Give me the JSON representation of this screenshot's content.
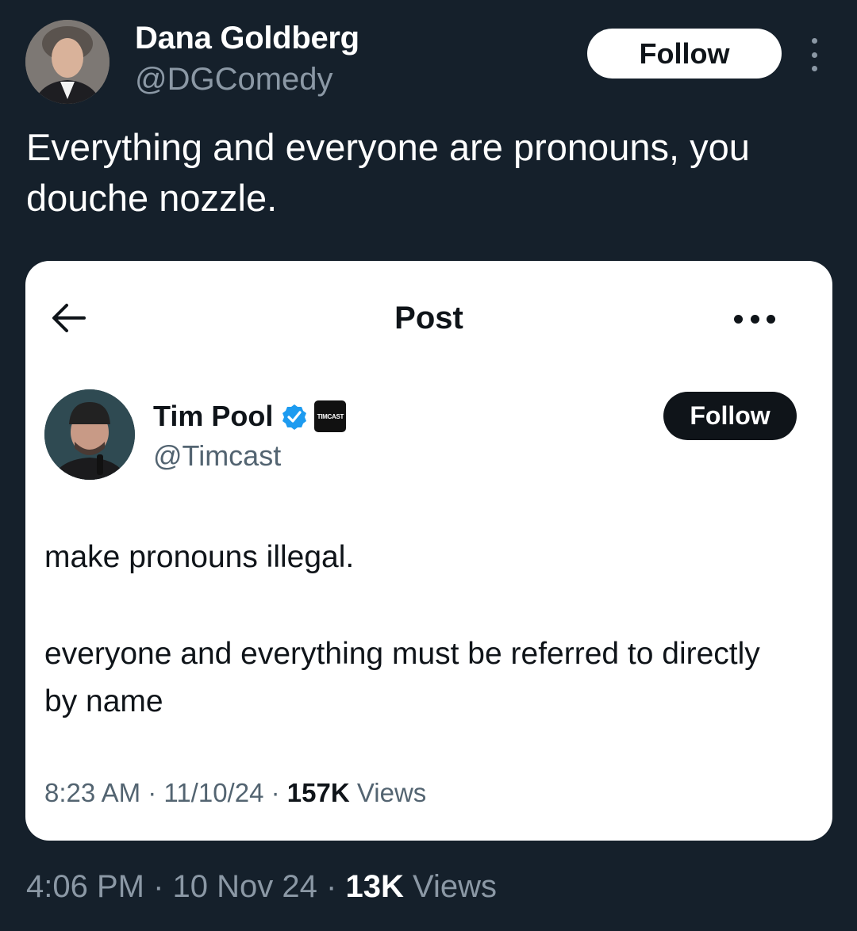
{
  "tweet": {
    "author_name": "Dana Goldberg",
    "author_handle": "@DGComedy",
    "follow_label": "Follow",
    "text": "Everything and everyone are pronouns, you douche nozzle.",
    "time": "4:06 PM",
    "date": "10 Nov 24",
    "views_count": "13K",
    "views_label": "Views",
    "separator": "·"
  },
  "quoted": {
    "header_title": "Post",
    "author_name": "Tim Pool",
    "author_handle": "@Timcast",
    "affiliate_badge_text": "TIMCAST",
    "follow_label": "Follow",
    "text_line1": "make pronouns illegal.",
    "text_line2": "everyone and everything must be referred to directly by name",
    "time": "8:23 AM",
    "date": "11/10/24",
    "views_count": "157K",
    "views_label": "Views",
    "separator": "·"
  },
  "colors": {
    "background": "#15202b",
    "secondary_text": "#8b98a5",
    "verified_blue": "#1d9bf0"
  }
}
